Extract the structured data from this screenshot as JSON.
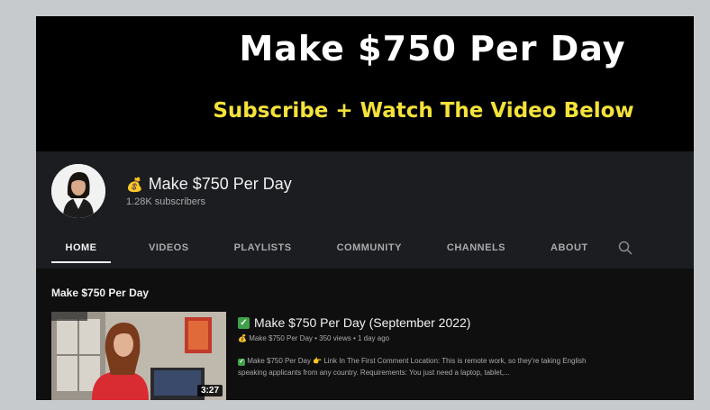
{
  "banner": {
    "title": "Make $750 Per Day",
    "subtitle": "Subscribe + Watch The Video Below"
  },
  "channel": {
    "icon": "money-bag-icon",
    "name": "Make $750 Per Day",
    "subscribers": "1.28K subscribers"
  },
  "tabs": [
    {
      "label": "HOME",
      "active": true
    },
    {
      "label": "VIDEOS"
    },
    {
      "label": "PLAYLISTS"
    },
    {
      "label": "COMMUNITY"
    },
    {
      "label": "CHANNELS"
    },
    {
      "label": "ABOUT"
    }
  ],
  "section": {
    "title": "Make $750 Per Day"
  },
  "video": {
    "title": "Make $750 Per Day (September 2022)",
    "meta": "Make $750 Per Day • 350 views • 1 day ago",
    "description_line1": "Make $750 Per Day 👉 Link In The First Comment Location: This is remote work, so they're taking English",
    "description_line2": "speaking applicants from any country. Requirements: You just need a laptop, tablet,...",
    "duration": "3:27"
  },
  "colors": {
    "banner_accent": "#f4e23a",
    "check_green": "#3fa14a"
  }
}
